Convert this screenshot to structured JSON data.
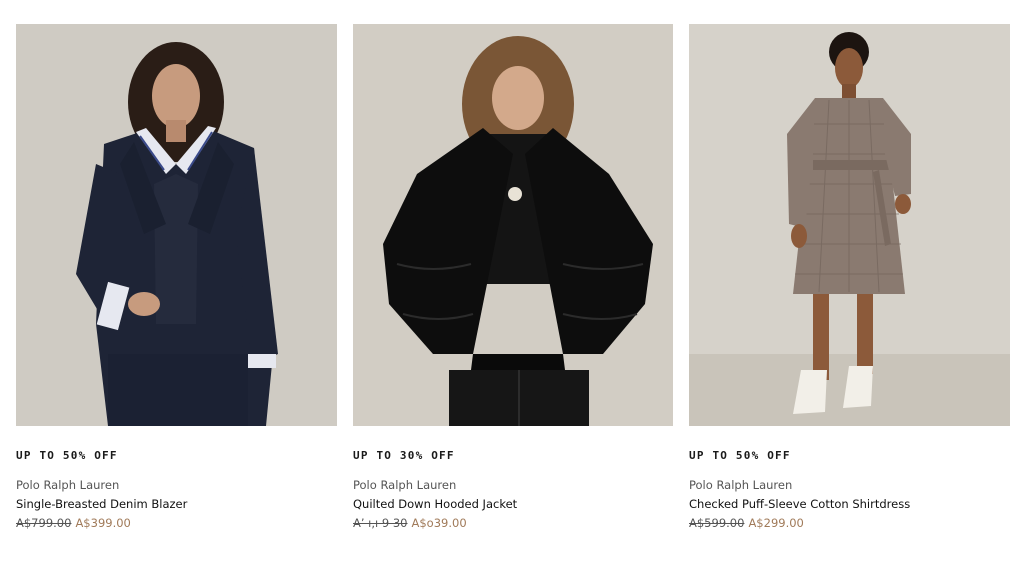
{
  "products": [
    {
      "badge": "UP TO 50% OFF",
      "brand": "Polo Ralph Lauren",
      "name": "Single-Breasted Denim Blazer",
      "old_price": "A$799.00",
      "new_price": "A$399.00"
    },
    {
      "badge": "UP TO 30% OFF",
      "brand": "Polo Ralph Lauren",
      "name": "Quilted Down Hooded Jacket",
      "old_price": "A’ ı,ı  9 30",
      "new_price": "A$o39.00"
    },
    {
      "badge": "UP TO 50% OFF",
      "brand": "Polo Ralph Lauren",
      "name": "Checked Puff-Sleeve Cotton Shirtdress",
      "old_price": "A$599.00",
      "new_price": "A$299.00"
    }
  ],
  "colors": {
    "sale_price": "#a07a59",
    "image_backdrop": "#cfcac2"
  }
}
